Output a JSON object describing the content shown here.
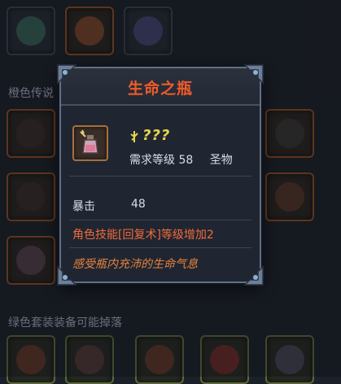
{
  "background": {
    "sections": [
      {
        "label": "橙色传说"
      },
      {
        "label": "绿色套装装备可能掉落"
      }
    ]
  },
  "tooltip": {
    "title": "生命之瓶",
    "quality": "???",
    "requirement_label": "需求等级",
    "requirement_level": "58",
    "item_type": "圣物",
    "stat_name": "暴击",
    "stat_value": "48",
    "skill_text": "角色技能[回复术]等级增加2",
    "flavor_text": "感受瓶内充沛的生命气息",
    "colors": {
      "title": "#f05a2a",
      "quality": "#e6d64a",
      "skill": "#f26a3c",
      "flavor": "#e8833f"
    },
    "icons": [
      "potion-bottle-icon",
      "quality-rune-icon"
    ]
  }
}
